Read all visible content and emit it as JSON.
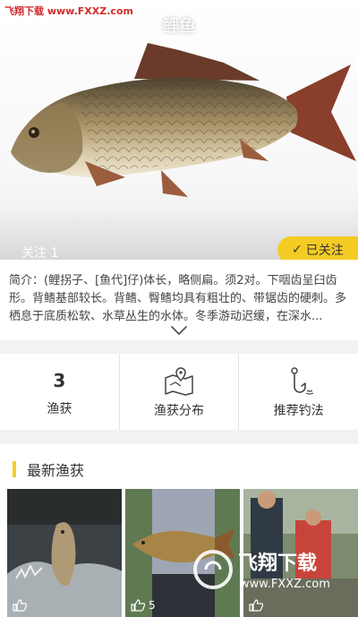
{
  "watermark_top": "飞翔下载 www.FXXZ.com",
  "header": {
    "title": "鲤鱼"
  },
  "follow": {
    "count_label": "关注 1",
    "button_label": "已关注"
  },
  "intro": {
    "text": "简介：(鲤拐子、[鱼代]仔)体长，略侧扁。须2对。下咽齿呈臼齿形。背鳍基部较长。背鳍、臀鳍均具有粗壮的、带锯齿的硬刺。多栖息于底质松软、水草丛生的水体。冬季游动迟缓，在深水..."
  },
  "stats": [
    {
      "number": "3",
      "label": "渔获",
      "icon": ""
    },
    {
      "number": "",
      "label": "渔获分布",
      "icon": "map-pin-icon"
    },
    {
      "number": "",
      "label": "推荐钓法",
      "icon": "fishing-hook-icon"
    }
  ],
  "latest": {
    "title": "最新渔获",
    "photos": [
      {
        "likes": ""
      },
      {
        "likes": "5"
      },
      {
        "likes": ""
      }
    ]
  },
  "watermark_bottom": {
    "brand": "飞翔下载",
    "url": "www.FXXZ.com"
  },
  "colors": {
    "accent": "#f5cc23",
    "watermark": "#d12b2b"
  }
}
